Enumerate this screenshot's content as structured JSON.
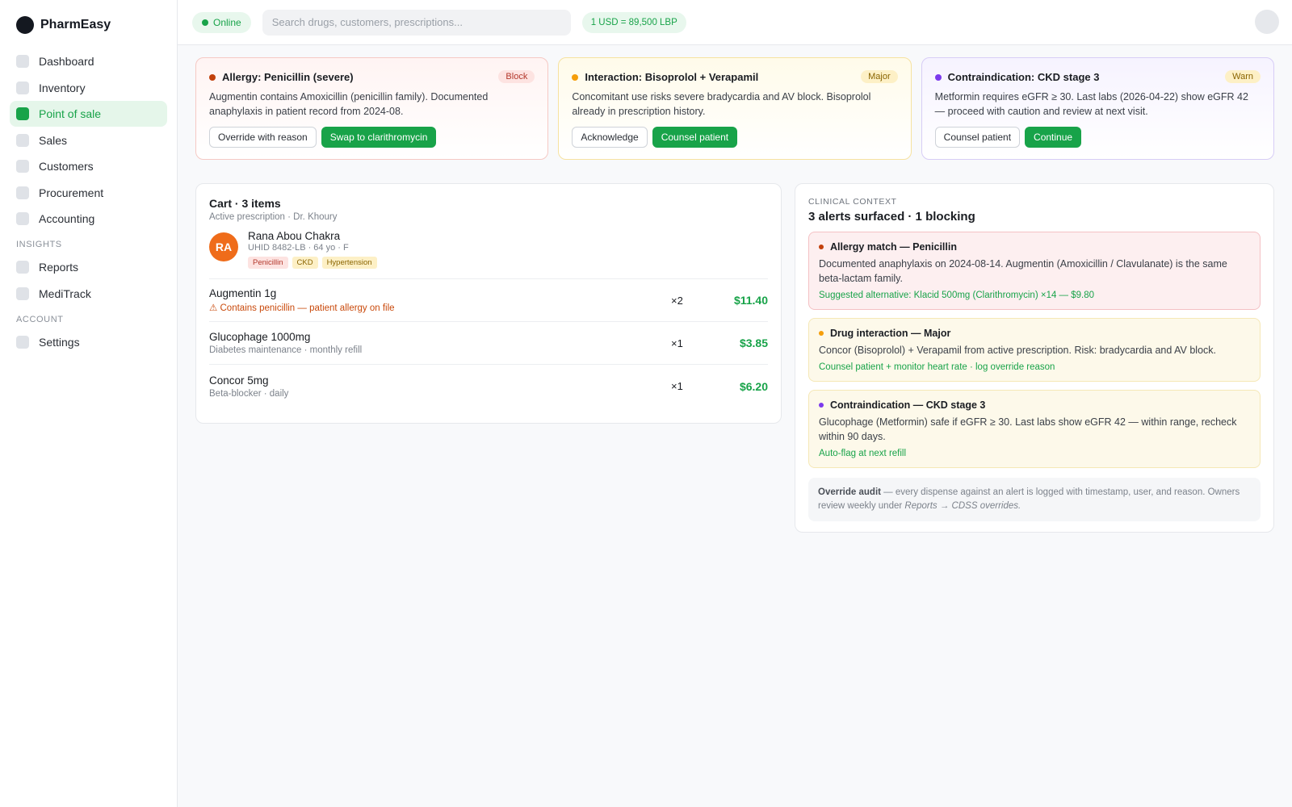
{
  "app": {
    "name": "PharmEasy"
  },
  "sidebar": {
    "items": [
      {
        "label": "Dashboard",
        "active": false
      },
      {
        "label": "Inventory",
        "active": false
      },
      {
        "label": "Point of sale",
        "active": true
      },
      {
        "label": "Sales",
        "active": false
      },
      {
        "label": "Customers",
        "active": false
      },
      {
        "label": "Procurement",
        "active": false
      },
      {
        "label": "Accounting",
        "active": false
      }
    ],
    "insights_label": "INSIGHTS",
    "insights_items": [
      {
        "label": "Reports"
      },
      {
        "label": "MediTrack"
      }
    ],
    "account_label": "ACCOUNT",
    "account_items": [
      {
        "label": "Settings"
      }
    ]
  },
  "topbar": {
    "status": "Online",
    "search_placeholder": "Search drugs, customers, prescriptions...",
    "fx_rate": "1 USD = 89,500 LBP"
  },
  "alerts": [
    {
      "title": "Allergy: Penicillin (severe)",
      "badge": "Block",
      "body": "Augmentin contains Amoxicillin (penicillin family). Documented anaphylaxis in patient record from 2024-08.",
      "btn_secondary": "Override with reason",
      "btn_primary": "Swap to clarithromycin"
    },
    {
      "title": "Interaction: Bisoprolol + Verapamil",
      "badge": "Major",
      "body": "Concomitant use risks severe bradycardia and AV block. Bisoprolol already in prescription history.",
      "btn_secondary": "Acknowledge",
      "btn_primary": "Counsel patient"
    },
    {
      "title": "Contraindication: CKD stage 3",
      "badge": "Warn",
      "body": "Metformin requires eGFR ≥ 30. Last labs (2026-04-22) show eGFR 42 — proceed with caution and review at next visit.",
      "btn_secondary": "Counsel patient",
      "btn_primary": "Continue"
    }
  ],
  "cart": {
    "title": "Cart · 3 items",
    "subtitle": "Active prescription · Dr. Khoury",
    "patient": {
      "initials": "RA",
      "name": "Rana Abou Chakra",
      "meta": "UHID 8482-LB · 64 yo · F",
      "tags": [
        "Penicillin",
        "CKD",
        "Hypertension"
      ]
    },
    "items": [
      {
        "name": "Augmentin 1g",
        "sub": "⚠ Contains penicillin — patient allergy on file",
        "qty": "×2",
        "price": "$11.40"
      },
      {
        "name": "Glucophage 1000mg",
        "sub": "Diabetes maintenance · monthly refill",
        "qty": "×1",
        "price": "$3.85"
      },
      {
        "name": "Concor 5mg",
        "sub": "Beta-blocker · daily",
        "qty": "×1",
        "price": "$6.20"
      }
    ]
  },
  "context": {
    "label": "CLINICAL CONTEXT",
    "title": "3 alerts surfaced · 1 blocking",
    "cards": [
      {
        "title": "Allergy match — Penicillin",
        "body": "Documented anaphylaxis on 2024-08-14. Augmentin (Amoxicillin / Clavulanate) is the same beta-lactam family.",
        "action": "Suggested alternative: Klacid 500mg (Clarithromycin) ×14 — $9.80"
      },
      {
        "title": "Drug interaction — Major",
        "body": "Concor (Bisoprolol) + Verapamil from active prescription. Risk: bradycardia and AV block.",
        "action": "Counsel patient + monitor heart rate · log override reason"
      },
      {
        "title": "Contraindication — CKD stage 3",
        "body": "Glucophage (Metformin) safe if eGFR ≥ 30. Last labs show eGFR 42 — within range, recheck within 90 days.",
        "action": "Auto-flag at next refill"
      }
    ],
    "audit_bold": "Override audit",
    "audit_text": " — every dispense against an alert is logged with timestamp, user, and reason. Owners review weekly under ",
    "audit_path": "Reports → CDSS overrides."
  },
  "colors": {
    "accent": "#18a349",
    "block": "#c2410c",
    "major": "#f59e0b",
    "warn": "#7c3aed"
  }
}
